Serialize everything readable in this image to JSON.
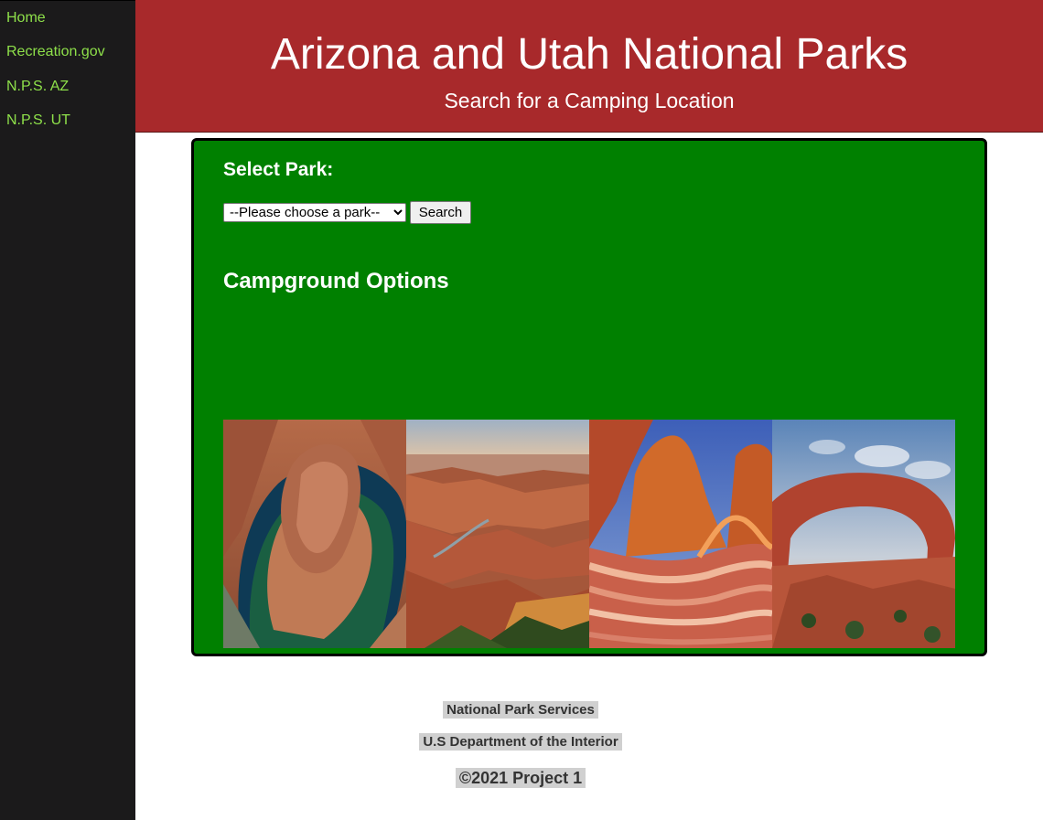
{
  "sidebar": {
    "items": [
      {
        "label": "Home"
      },
      {
        "label": "Recreation.gov"
      },
      {
        "label": "N.P.S. AZ"
      },
      {
        "label": "N.P.S. UT"
      }
    ]
  },
  "header": {
    "title": "Arizona and Utah National Parks",
    "subtitle": "Search for a Camping Location"
  },
  "main": {
    "select_heading": "Select Park:",
    "park_select": {
      "selected": "--Please choose a park--",
      "options": [
        "--Please choose a park--"
      ]
    },
    "search_label": "Search",
    "campground_heading": "Campground Options",
    "photos": [
      {
        "name": "horseshoe-bend-photo"
      },
      {
        "name": "grand-canyon-photo"
      },
      {
        "name": "the-wave-photo"
      },
      {
        "name": "arch-photo"
      }
    ]
  },
  "footer": {
    "line1": "National Park Services",
    "line2": "U.S Department of the Interior",
    "line3": "©2021 Project 1"
  },
  "colors": {
    "sidebar_bg": "#1b1a1b",
    "sidebar_link": "#8ee04a",
    "header_bg": "#a8292b",
    "panel_bg": "#008000"
  }
}
